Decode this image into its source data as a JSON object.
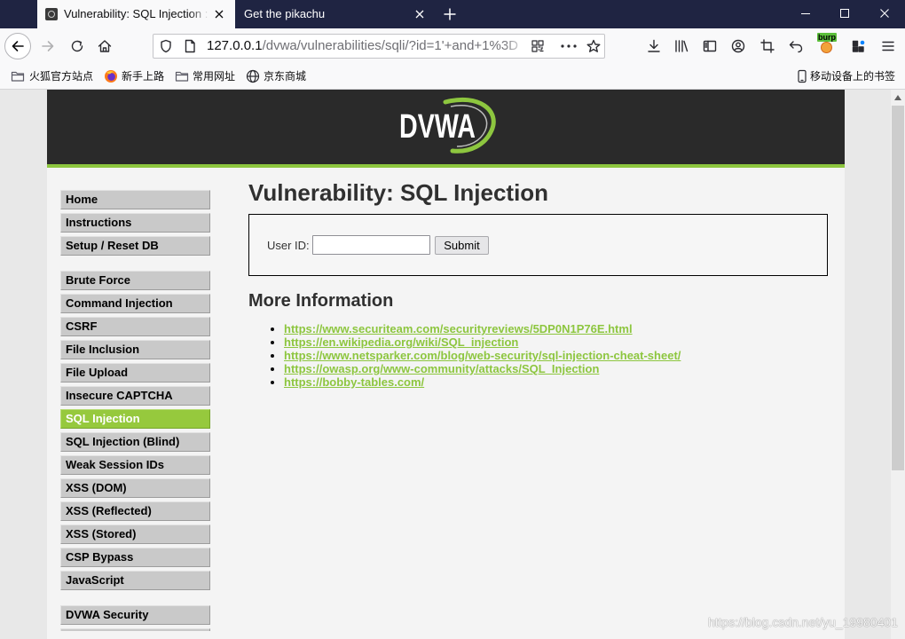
{
  "browser": {
    "tabs": [
      {
        "title": "Vulnerability: SQL Injection ::",
        "active": true
      },
      {
        "title": "Get the pikachu",
        "active": false
      }
    ],
    "url": {
      "host": "127.0.0.1",
      "path": "/dvwa/vulnerabilities/sqli/?id=1'+and+1%3D"
    },
    "toolbar_icons": [
      "back-icon",
      "forward-icon",
      "reload-icon",
      "home-icon",
      "download-icon",
      "library-icon",
      "sidebar-icon",
      "account-icon",
      "screenshot-icon",
      "undo-icon",
      "burp-extension-icon",
      "extensions-icon",
      "menu-icon"
    ],
    "extension_badge": "burp",
    "bookmarks": [
      {
        "label": "火狐官方站点",
        "icon": "folder-icon"
      },
      {
        "label": "新手上路",
        "icon": "firefox-icon"
      },
      {
        "label": "常用网址",
        "icon": "folder-icon"
      },
      {
        "label": "京东商城",
        "icon": "globe-icon"
      }
    ],
    "mobile_bookmarks": {
      "label": "移动设备上的书签",
      "icon": "phone-icon"
    }
  },
  "dvwa": {
    "logo_text": "DVWA",
    "menu": {
      "groups": [
        [
          "Home",
          "Instructions",
          "Setup / Reset DB"
        ],
        [
          "Brute Force",
          "Command Injection",
          "CSRF",
          "File Inclusion",
          "File Upload",
          "Insecure CAPTCHA",
          "SQL Injection",
          "SQL Injection (Blind)",
          "Weak Session IDs",
          "XSS (DOM)",
          "XSS (Reflected)",
          "XSS (Stored)",
          "CSP Bypass",
          "JavaScript"
        ],
        [
          "DVWA Security"
        ]
      ],
      "active_item": {
        "group": 1,
        "index": 6
      }
    },
    "page_title": "Vulnerability: SQL Injection",
    "form": {
      "user_id_label": "User ID:",
      "submit_label": "Submit"
    },
    "more_info": {
      "heading": "More Information",
      "links": [
        "https://www.securiteam.com/securityreviews/5DP0N1P76E.html",
        "https://en.wikipedia.org/wiki/SQL_injection",
        "https://www.netsparker.com/blog/web-security/sql-injection-cheat-sheet/",
        "https://owasp.org/www-community/attacks/SQL_Injection",
        "https://bobby-tables.com/"
      ]
    }
  },
  "watermark": "https://blog.csdn.net/yu_19980401",
  "colors": {
    "tabbar": "#1f2442",
    "chrome": "#f9f9fa",
    "green": "#8dc63f",
    "active-menu": "#96c93d",
    "header": "#2a2a2a"
  }
}
